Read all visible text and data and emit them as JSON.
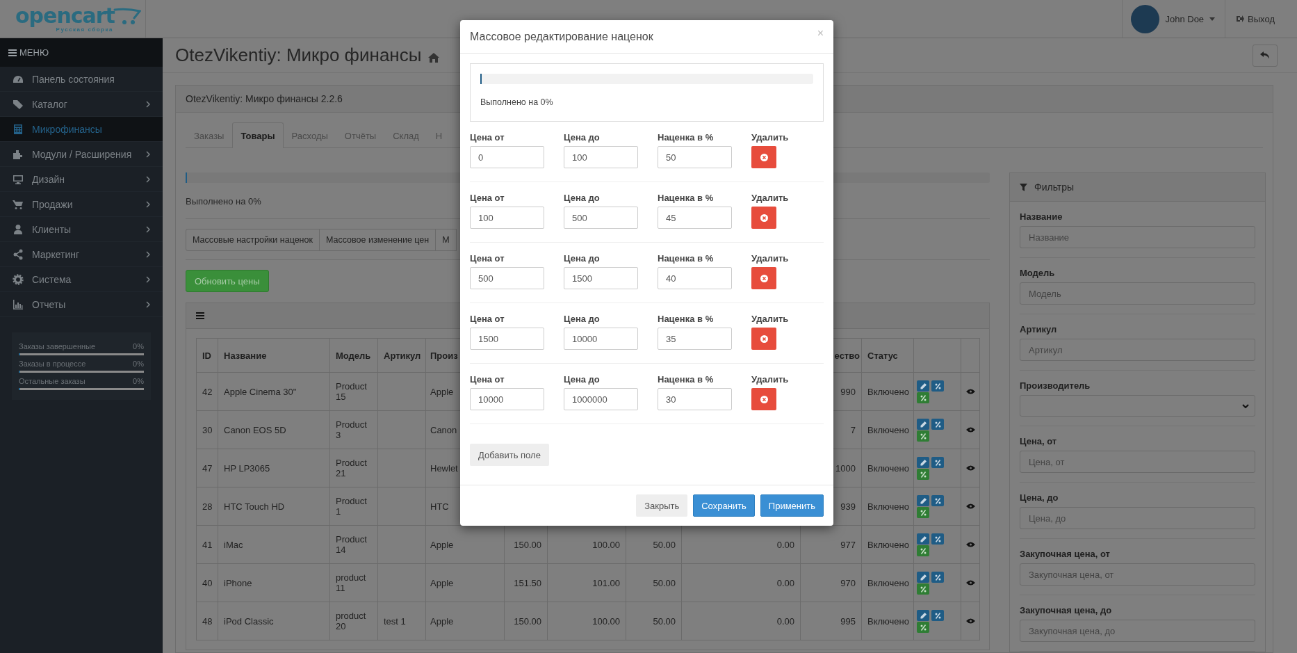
{
  "header": {
    "logo_text": "opencart",
    "logo_subtitle": "Русская сборка",
    "user": "John Doe",
    "logout": "Выход"
  },
  "sidebar": {
    "menu_title": "МЕНЮ",
    "items": [
      {
        "label": "Панель состояния",
        "expandable": false,
        "selected": false
      },
      {
        "label": "Каталог",
        "expandable": true,
        "selected": false
      },
      {
        "label": "Микрофинансы",
        "expandable": false,
        "selected": true
      },
      {
        "label": "Модули / Расширения",
        "expandable": true,
        "selected": false
      },
      {
        "label": "Дизайн",
        "expandable": true,
        "selected": false
      },
      {
        "label": "Продажи",
        "expandable": true,
        "selected": false
      },
      {
        "label": "Клиенты",
        "expandable": true,
        "selected": false
      },
      {
        "label": "Маркетинг",
        "expandable": true,
        "selected": false
      },
      {
        "label": "Система",
        "expandable": true,
        "selected": false
      },
      {
        "label": "Отчеты",
        "expandable": true,
        "selected": false
      }
    ],
    "stats": [
      {
        "label": "Заказы завершенные",
        "value": "0%",
        "level": 0
      },
      {
        "label": "Заказы в процессе",
        "value": "0%",
        "level": 0
      },
      {
        "label": "Остальные заказы",
        "value": "0%",
        "level": 0
      }
    ]
  },
  "page": {
    "title": "OtezVikentiy: Микро финансы"
  },
  "panel": {
    "title": "OtezVikentiy: Микро финансы 2.2.6",
    "tabs": [
      {
        "label": "Заказы",
        "selected": false
      },
      {
        "label": "Товары",
        "selected": true
      },
      {
        "label": "Расходы",
        "selected": false
      },
      {
        "label": "Отчёты",
        "selected": false
      },
      {
        "label": "Склад",
        "selected": false
      },
      {
        "label": "Н",
        "selected": false
      }
    ],
    "progress": {
      "level": 0,
      "text": "Выполнено на 0%"
    },
    "mass_buttons": [
      "Массовые настройки наценок",
      "Массовое изменение цен",
      "М"
    ],
    "update_button": "Обновить цены",
    "table": {
      "columns": [
        "ID",
        "Название",
        "Модель",
        "Артикул",
        "Произ",
        null,
        null,
        null,
        null,
        "ество",
        "Статус"
      ],
      "rows": [
        {
          "cells": [
            "42",
            "Apple Cinema 30\"",
            "Product 15",
            null,
            "Apple",
            null,
            null,
            null,
            null,
            "990",
            "Включено"
          ]
        },
        {
          "cells": [
            "30",
            "Canon EOS 5D",
            "Product 3",
            null,
            "Canon",
            null,
            null,
            null,
            null,
            "7",
            "Включено"
          ]
        },
        {
          "cells": [
            "47",
            "HP LP3065",
            "Product 21",
            null,
            "Hewlet",
            null,
            null,
            null,
            null,
            "1000",
            "Включено"
          ]
        },
        {
          "cells": [
            "28",
            "HTC Touch HD",
            "Product 1",
            null,
            "HTC",
            null,
            null,
            null,
            null,
            "939",
            "Включено"
          ]
        },
        {
          "cells": [
            "41",
            "iMac",
            "Product 14",
            null,
            "Apple",
            "150.00",
            "100.00",
            "50.00",
            "0.00",
            "977",
            "Включено"
          ]
        },
        {
          "cells": [
            "40",
            "iPhone",
            "product 11",
            null,
            "Apple",
            "151.50",
            "101.00",
            "50.00",
            "0.00",
            "970",
            "Включено"
          ]
        },
        {
          "cells": [
            "48",
            "iPod Classic",
            "product 20",
            "test 1",
            "Apple",
            "150.00",
            "100.00",
            "50.00",
            "0.00",
            "995",
            "Включено"
          ]
        }
      ]
    }
  },
  "filters": {
    "title": "Фильтры",
    "fields": [
      {
        "kind": "text",
        "label": "Название",
        "placeholder": "Название"
      },
      {
        "kind": "text",
        "label": "Модель",
        "placeholder": "Модель"
      },
      {
        "kind": "text",
        "label": "Артикул",
        "placeholder": "Артикул"
      },
      {
        "kind": "select",
        "label": "Производитель"
      },
      {
        "kind": "text",
        "label": "Цена, от",
        "placeholder": "Цена, от"
      },
      {
        "kind": "text",
        "label": "Цена, до",
        "placeholder": "Цена, до"
      },
      {
        "kind": "text",
        "label": "Закупочная цена, от",
        "placeholder": "Закупочная цена, от"
      },
      {
        "kind": "text",
        "label": "Закупочная цена, до",
        "placeholder": "Закупочная цена, до"
      }
    ]
  },
  "modal": {
    "title": "Массовое редактирование наценок",
    "close": "×",
    "progress": {
      "level": 0,
      "text": "Выполнено на 0%"
    },
    "rows": [
      {
        "from_label": "Цена от",
        "from": "0",
        "to_label": "Цена до",
        "to": "100",
        "markup_label": "Наценка в %",
        "markup": "50",
        "delete_label": "Удалить"
      },
      {
        "from_label": "Цена от",
        "from": "100",
        "to_label": "Цена до",
        "to": "500",
        "markup_label": "Наценка в %",
        "markup": "45",
        "delete_label": "Удалить"
      },
      {
        "from_label": "Цена от",
        "from": "500",
        "to_label": "Цена до",
        "to": "1500",
        "markup_label": "Наценка в %",
        "markup": "40",
        "delete_label": "Удалить"
      },
      {
        "from_label": "Цена от",
        "from": "1500",
        "to_label": "Цена до",
        "to": "10000",
        "markup_label": "Наценка в %",
        "markup": "35",
        "delete_label": "Удалить"
      },
      {
        "from_label": "Цена от",
        "from": "10000",
        "to_label": "Цена до",
        "to": "1000000",
        "markup_label": "Наценка в %",
        "markup": "30",
        "delete_label": "Удалить"
      }
    ],
    "add_button": "Добавить поле",
    "buttons": [
      {
        "label": "Закрыть",
        "kind": "default"
      },
      {
        "label": "Сохранить",
        "kind": "primary"
      },
      {
        "label": "Применить",
        "kind": "primary"
      }
    ]
  }
}
